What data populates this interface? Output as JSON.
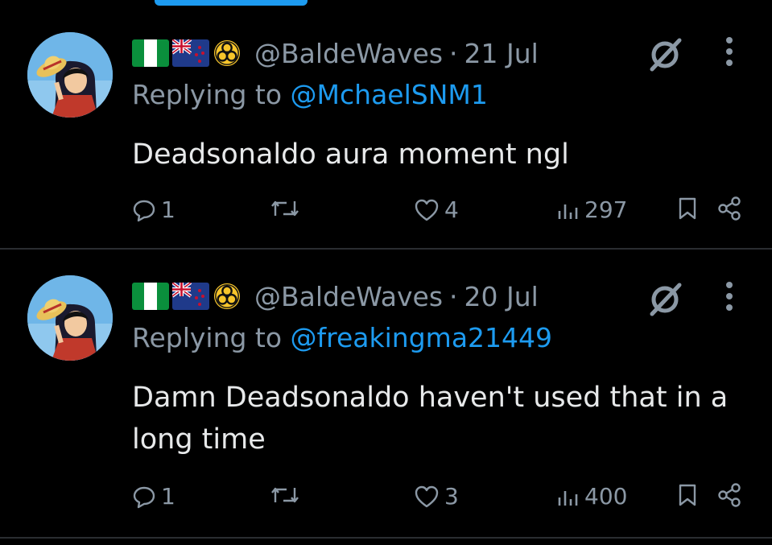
{
  "tweets": [
    {
      "handle": "@BaldeWaves",
      "separator": "·",
      "date": "21 Jul",
      "reply_prefix": "Replying to",
      "reply_to": "@MchaelSNM1",
      "text": "Deadsonaldo aura moment ngl",
      "replies": "1",
      "likes": "4",
      "views": "297"
    },
    {
      "handle": "@BaldeWaves",
      "separator": "·",
      "date": "20 Jul",
      "reply_prefix": "Replying to",
      "reply_to": "@freakingma21449",
      "text": "Damn Deadsonaldo haven't used that in a long time",
      "replies": "1",
      "likes": "3",
      "views": "400"
    }
  ],
  "icons": {
    "flags": [
      "nigeria-flag-icon",
      "new-zealand-flag-icon",
      "biohazard-icon"
    ],
    "header": [
      "grok-icon",
      "more-options-icon"
    ],
    "actions": [
      "reply-icon",
      "retweet-icon",
      "like-icon",
      "views-icon",
      "bookmark-icon",
      "share-icon"
    ]
  },
  "colors": {
    "background": "#000000",
    "text": "#e7e9ea",
    "muted": "#8b98a5",
    "accent": "#1d9bf0",
    "divider": "#2a2d31"
  }
}
